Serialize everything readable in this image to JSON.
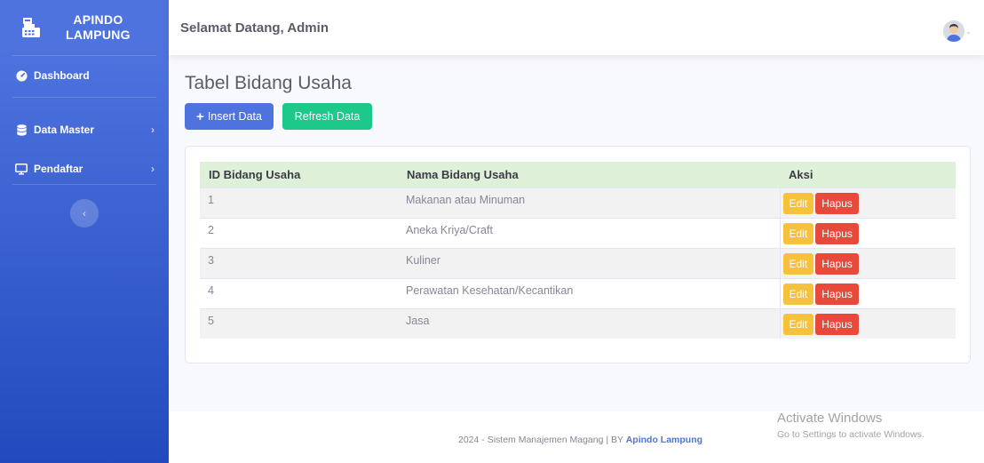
{
  "sidebar": {
    "brand_line1": "APINDO",
    "brand_line2": "LAMPUNG",
    "items": [
      {
        "label": "Dashboard"
      },
      {
        "label": "Data Master"
      },
      {
        "label": "Pendaftar"
      }
    ]
  },
  "topbar": {
    "welcome": "Selamat Datang, Admin"
  },
  "main": {
    "title": "Tabel Bidang Usaha",
    "insert_label": "Insert Data",
    "refresh_label": "Refresh Data"
  },
  "table": {
    "headers": [
      "ID Bidang Usaha",
      "Nama Bidang Usaha",
      "Aksi"
    ],
    "rows": [
      {
        "id": "1",
        "nama": "Makanan atau Minuman"
      },
      {
        "id": "2",
        "nama": "Aneka Kriya/Craft"
      },
      {
        "id": "3",
        "nama": "Kuliner"
      },
      {
        "id": "4",
        "nama": "Perawatan Kesehatan/Kecantikan"
      },
      {
        "id": "5",
        "nama": "Jasa"
      }
    ],
    "edit_label": "Edit",
    "hapus_label": "Hapus"
  },
  "footer": {
    "text": "2024 - Sistem Manajemen Magang | BY ",
    "link": "Apindo Lampung"
  },
  "watermark": {
    "line1": "Activate Windows",
    "line2": "Go to Settings to activate Windows."
  },
  "colors": {
    "primary": "#4e73df",
    "success": "#1cc88a",
    "warning": "#f6c23e",
    "danger": "#e74a3b"
  }
}
